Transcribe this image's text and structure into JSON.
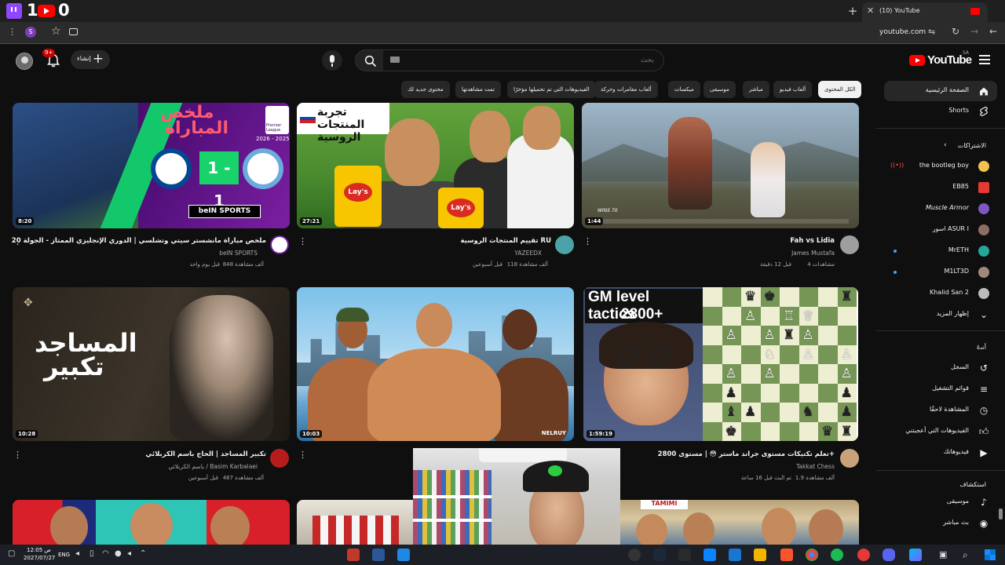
{
  "overlay": {
    "num_left": "1",
    "num_right": "0"
  },
  "browser": {
    "tab_title": "(10) YouTube",
    "url": "youtube.com",
    "profile_letter": "S"
  },
  "header": {
    "logo_text": "YouTube",
    "logo_region": "SA",
    "search_placeholder": "بحث",
    "create_label": "إنشاء",
    "notification_count": "9+"
  },
  "chips": [
    {
      "label": "الكل المحتوى",
      "active": true
    },
    {
      "label": "ألعاب فيديو"
    },
    {
      "label": "مباشر"
    },
    {
      "label": "موسيقى"
    },
    {
      "label": "ميكسات"
    },
    {
      "label": "ألعاب مغامرات وحركة"
    },
    {
      "label": "الفيديوهات التي تم تحميلها مؤخرًا"
    },
    {
      "label": "تمت مشاهدتها"
    },
    {
      "label": "محتوى جديد لك"
    }
  ],
  "sidebar": {
    "home": "الصفحة الرئيسية",
    "shorts": "Shorts",
    "subscriptions_header": "الاشتراكات",
    "subscriptions": [
      {
        "name": "the bootleg boy",
        "live": true,
        "color": "#f2c14e"
      },
      {
        "name": "EB85",
        "color": "#e53935"
      },
      {
        "name": "Muscle Armor",
        "color": "#7e57c2"
      },
      {
        "name": "اسور ASUR I",
        "color": "#8d6e63"
      },
      {
        "name": "MrETH",
        "dot": true,
        "color": "#26a69a"
      },
      {
        "name": "M1LT3D",
        "dot": true,
        "color": "#a1887f"
      },
      {
        "name": "Khalid San 2",
        "color": "#bdbdbd"
      }
    ],
    "show_more": "إظهار المزيد",
    "you_header": "أنت",
    "you_items": [
      {
        "label": "السجل",
        "icon": "history-icon"
      },
      {
        "label": "قوائم التشغيل",
        "icon": "playlist-icon"
      },
      {
        "label": "المشاهدة لاحقًا",
        "icon": "clock-icon"
      },
      {
        "label": "الفيديوهات التي أعجبتني",
        "icon": "thumbs-up-icon"
      },
      {
        "label": "فيديوهاتك",
        "icon": "play-square-icon"
      }
    ],
    "explore_header": "استكشاف",
    "explore_items": [
      {
        "label": "موسيقى",
        "icon": "music-icon"
      },
      {
        "label": "بث مباشر",
        "icon": "live-icon"
      }
    ]
  },
  "videos": [
    {
      "title": "ملخص مباراة مانشستر سيتي وتشلسي | الدوري الإنجليزي الممتاز - الجولة 20",
      "channel": "beIN SPORTS",
      "verified": true,
      "views": "848 ألف مشاهدة",
      "age": "قبل يوم واحد",
      "duration": "8:20",
      "thumb_text_1": "ملخص",
      "thumb_text_2": "المباراة",
      "score": "1 - 1",
      "season": "2026 - 2025",
      "brand": "beIN SPORTS",
      "league": "Premier League"
    },
    {
      "title": "تقييم المنتجات الروسية RU",
      "channel": "YAZEEDX",
      "verified": true,
      "views": "118 ألف مشاهدة",
      "age": "قبل أسبوعين",
      "duration": "27:21",
      "thumb_text": "تجربة المنتجات الروسية",
      "bag_text": "Lay's"
    },
    {
      "title": "Fah vs Lidia",
      "channel": "James Mustafa",
      "verified": false,
      "views": "4 مشاهدات",
      "age": "قبل 12 دقيقة",
      "duration": "1:44",
      "hud_text": "WINS 70"
    },
    {
      "title": "تكبير المساجد | الحاج باسم الكربلائي",
      "channel": "باسم الكربلائي / Basim Karbalaei",
      "verified": true,
      "views": "467 ألف مشاهدة",
      "age": "قبل أسبوعين",
      "duration": "10:28",
      "thumb_text_1": "تكبير",
      "thumb_text_2": "المساجد"
    },
    {
      "title": "",
      "channel": "",
      "views": "",
      "age": "",
      "duration": "10:03",
      "thumb_text": "NELRUY"
    },
    {
      "title": "تعلم تكتيكات مستوى جراند ماستر 😳 | مستوى 2800+",
      "channel": "Takkat Chess",
      "verified": true,
      "views": "1.9 ألف مشاهدة",
      "age": "تم البث قبل 16 ساعة",
      "duration": "1:59:19",
      "thumb_line_1": "GM level tactics",
      "thumb_line_2": "2800+"
    }
  ],
  "taskbar": {
    "time": "ص 12:05",
    "date": "2027/07/27",
    "language": "ENG"
  },
  "colors": {
    "background": "#0f0f0f",
    "chip": "#272727",
    "accent_red": "#ff0000",
    "link_blue": "#3ea6ff"
  }
}
